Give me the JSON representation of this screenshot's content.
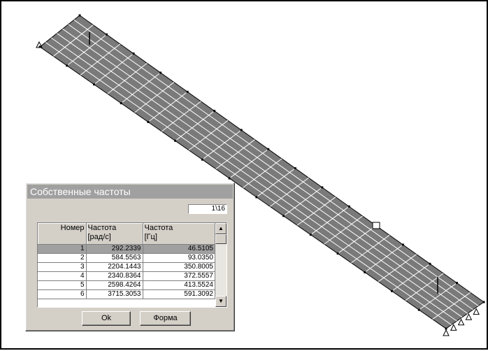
{
  "dialog": {
    "title": "Собственные частоты",
    "page_indicator": "1\\16",
    "table": {
      "headers": [
        "Номер",
        "Частота\n[рад/с]",
        "Частота\n[Гц]"
      ],
      "header_lines": [
        [
          "Номер"
        ],
        [
          "Частота",
          "[рад/с]"
        ],
        [
          "Частота",
          "[Гц]"
        ]
      ],
      "rows": [
        [
          "1",
          "292.2339",
          "46.5105"
        ],
        [
          "2",
          "584.5563",
          "93.0350"
        ],
        [
          "3",
          "2204.1443",
          "350.8005"
        ],
        [
          "4",
          "2340.8364",
          "372.5557"
        ],
        [
          "5",
          "2598.4264",
          "413.5524"
        ],
        [
          "6",
          "3715.3053",
          "591.3092"
        ]
      ],
      "selected_row": 1
    },
    "scroll_up_icon": "triangle-up-icon",
    "scroll_down_icon": "triangle-down-icon",
    "ok_label": "Ok",
    "forma_label": "Форма"
  },
  "colors": {
    "plate": "#7a7a7a",
    "title_bar": "#a0a0a0",
    "dialog_face": "#d4d0c8",
    "selection": "#a0a0a0"
  }
}
